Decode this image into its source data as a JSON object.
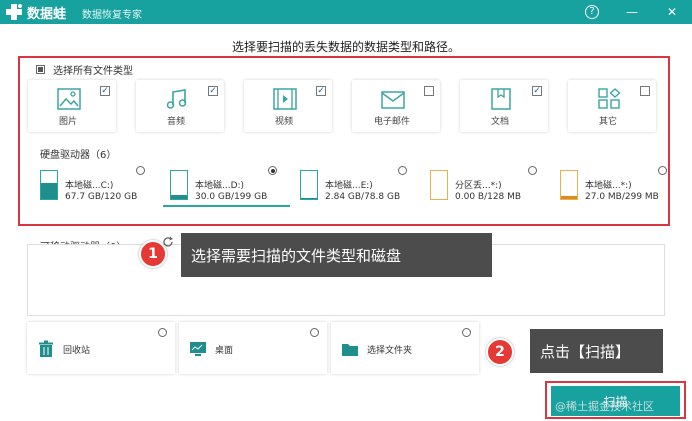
{
  "app": {
    "name": "数据蛙",
    "subtitle": "数据恢复专家",
    "help_glyph": "?",
    "minimize_glyph": "—",
    "close_glyph": "✕"
  },
  "heading": "选择要扫描的丢失数据的数据类型和路径。",
  "select_all_label": "选择所有文件类型",
  "file_types": [
    {
      "label": "图片",
      "checked": true,
      "check_glyph": "✓",
      "icon": "image-icon"
    },
    {
      "label": "音频",
      "checked": true,
      "check_glyph": "✓",
      "icon": "music-icon"
    },
    {
      "label": "视频",
      "checked": true,
      "check_glyph": "✓",
      "icon": "video-icon"
    },
    {
      "label": "电子邮件",
      "checked": false,
      "check_glyph": "",
      "icon": "mail-icon"
    },
    {
      "label": "文档",
      "checked": true,
      "check_glyph": "✓",
      "icon": "document-icon"
    },
    {
      "label": "其它",
      "checked": false,
      "check_glyph": "",
      "icon": "other-icon"
    }
  ],
  "hard_drives_label": "硬盘驱动器（6）",
  "drives": [
    {
      "name": "本地磁...C:)",
      "size": "67.7 GB/120 GB",
      "usage": 0.56,
      "selected": false
    },
    {
      "name": "本地磁...D:)",
      "size": "30.0 GB/199 GB",
      "usage": 0.15,
      "selected": true
    },
    {
      "name": "本地磁...E:)",
      "size": "2.84 GB/78.8 GB",
      "usage": 0.04,
      "selected": false
    },
    {
      "name": "分区丢...*:)",
      "size": "0.00  B/128 MB",
      "usage": 0.0,
      "selected": false
    },
    {
      "name": "本地磁...*:)",
      "size": "27.0 MB/299 MB",
      "usage": 0.09,
      "selected": false
    }
  ],
  "removable_label": "可移动驱动器（0）",
  "locations": [
    {
      "label": "回收站",
      "icon": "trash-icon"
    },
    {
      "label": "桌面",
      "icon": "desktop-icon"
    },
    {
      "label": "选择文件夹",
      "icon": "folder-icon"
    }
  ],
  "annotations": [
    {
      "number": "1",
      "text": "选择需要扫描的文件类型和磁盘"
    },
    {
      "number": "2",
      "text": "点击【扫描】"
    }
  ],
  "scan_button": "扫描",
  "watermark": "@稀土掘金技术社区",
  "colors": {
    "accent": "#17a2a0",
    "highlight": "#d9363e",
    "annotation_bg": "#4c4c4c",
    "annotation_badge": "#e53935"
  }
}
